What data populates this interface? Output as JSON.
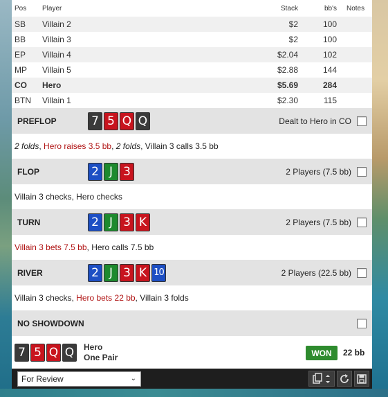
{
  "players": {
    "headers": {
      "pos": "Pos",
      "player": "Player",
      "stack": "Stack",
      "bb": "bb's",
      "notes": "Notes"
    },
    "rows": [
      {
        "pos": "SB",
        "player": "Villain 2",
        "stack": "$2",
        "bb": "100"
      },
      {
        "pos": "BB",
        "player": "Villain 3",
        "stack": "$2",
        "bb": "100"
      },
      {
        "pos": "EP",
        "player": "Villain 4",
        "stack": "$2.04",
        "bb": "102"
      },
      {
        "pos": "MP",
        "player": "Villain 5",
        "stack": "$2.88",
        "bb": "144"
      },
      {
        "pos": "CO",
        "player": "Hero",
        "stack": "$5.69",
        "bb": "284"
      },
      {
        "pos": "BTN",
        "player": "Villain 1",
        "stack": "$2.30",
        "bb": "115"
      }
    ]
  },
  "streets": {
    "preflop": {
      "name": "PREFLOP",
      "cards": [
        {
          "rank": "7",
          "suit": "spade"
        },
        {
          "rank": "5",
          "suit": "heart"
        },
        {
          "rank": "Q",
          "suit": "heart"
        },
        {
          "rank": "Q",
          "suit": "spade"
        }
      ],
      "info": "Dealt to Hero in CO",
      "actions": [
        {
          "text": "2 folds",
          "style": "italic"
        },
        {
          "text": ", ",
          "style": "plain"
        },
        {
          "text": "Hero raises 3.5 bb",
          "style": "red"
        },
        {
          "text": ", ",
          "style": "plain"
        },
        {
          "text": "2 folds",
          "style": "italic"
        },
        {
          "text": ", Villain 3 calls 3.5 bb",
          "style": "plain"
        }
      ]
    },
    "flop": {
      "name": "FLOP",
      "cards": [
        {
          "rank": "2",
          "suit": "diamond"
        },
        {
          "rank": "J",
          "suit": "club"
        },
        {
          "rank": "3",
          "suit": "heart"
        }
      ],
      "info": "2 Players (7.5 bb)",
      "actions": [
        {
          "text": "Villain 3 checks, Hero checks",
          "style": "plain"
        }
      ]
    },
    "turn": {
      "name": "TURN",
      "cards": [
        {
          "rank": "2",
          "suit": "diamond"
        },
        {
          "rank": "J",
          "suit": "club"
        },
        {
          "rank": "3",
          "suit": "heart"
        },
        {
          "rank": "K",
          "suit": "heart"
        }
      ],
      "info": "2 Players (7.5 bb)",
      "actions": [
        {
          "text": "Villain 3 bets 7.5 bb",
          "style": "red"
        },
        {
          "text": ", Hero calls 7.5 bb",
          "style": "plain"
        }
      ]
    },
    "river": {
      "name": "RIVER",
      "cards": [
        {
          "rank": "2",
          "suit": "diamond"
        },
        {
          "rank": "J",
          "suit": "club"
        },
        {
          "rank": "3",
          "suit": "heart"
        },
        {
          "rank": "K",
          "suit": "heart"
        },
        {
          "rank": "10",
          "suit": "diamond"
        }
      ],
      "info": "2 Players (22.5 bb)",
      "actions": [
        {
          "text": "Villain 3 checks, ",
          "style": "plain"
        },
        {
          "text": "Hero bets 22 bb",
          "style": "red"
        },
        {
          "text": ", Villain 3 folds",
          "style": "plain"
        }
      ]
    },
    "showdown": {
      "name": "NO SHOWDOWN"
    }
  },
  "result": {
    "cards": [
      {
        "rank": "7",
        "suit": "spade"
      },
      {
        "rank": "5",
        "suit": "heart"
      },
      {
        "rank": "Q",
        "suit": "heart"
      },
      {
        "rank": "Q",
        "suit": "spade"
      }
    ],
    "player": "Hero",
    "hand": "One Pair",
    "badge": "WON",
    "amount": "22 bb"
  },
  "footer": {
    "select_value": "For Review",
    "buttons": [
      "copy-icon",
      "refresh-icon",
      "save-icon"
    ]
  },
  "colors": {
    "won": "#2e8b2e",
    "action_red": "#b01414",
    "footer_bg": "#1e1e1e"
  }
}
